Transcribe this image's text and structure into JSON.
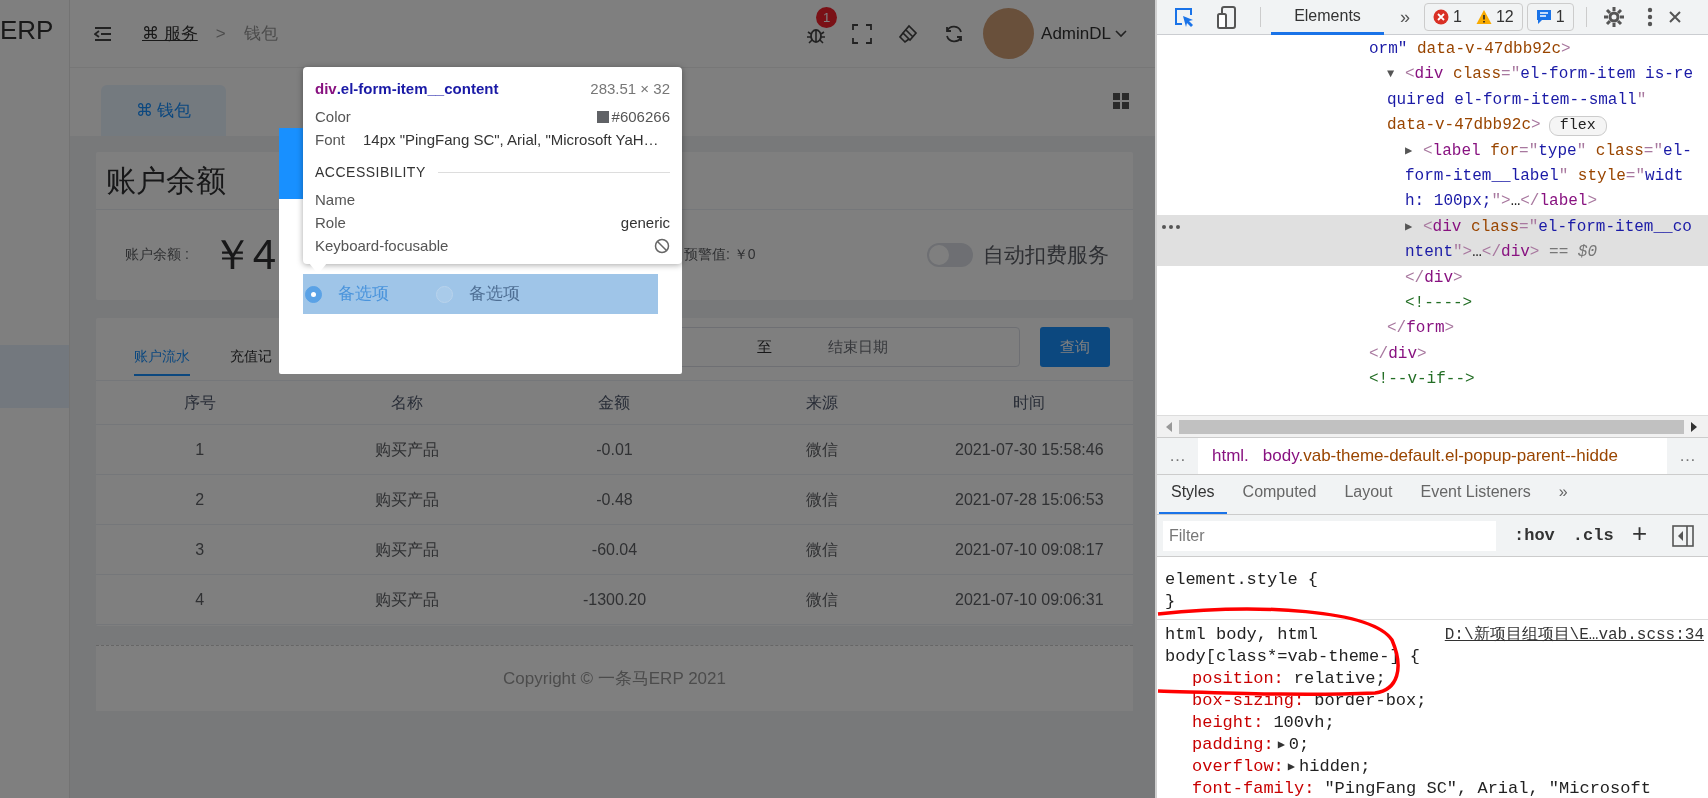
{
  "app": {
    "sidebar": {
      "logo_text": "ERP",
      "items": [
        {
          "selected": true
        }
      ]
    },
    "header": {
      "breadcrumb": [
        {
          "kind": "link",
          "text": "⌘ 服务"
        },
        {
          "kind": "separator",
          "text": ">"
        },
        {
          "kind": "current",
          "text": "钱包"
        }
      ],
      "notification_count": "1",
      "user": "AdminDL"
    },
    "tabs": [
      {
        "label": "⌘ 钱包",
        "selected": true
      }
    ],
    "balance_card": {
      "title": "账户余额",
      "balance_label": "账户余额 :",
      "balance_value": "￥4",
      "warning": "预警值: ￥0",
      "auto_pay": {
        "label": "自动扣费服务",
        "on": false
      }
    },
    "records_card": {
      "tabs": [
        {
          "label": "账户流水",
          "selected": true
        },
        {
          "label": "充值记",
          "selected": false
        }
      ],
      "date_range": {
        "separator": "至",
        "end_placeholder": "结束日期"
      },
      "query_button": "查询",
      "table": {
        "columns": [
          "序号",
          "名称",
          "金额",
          "来源",
          "时间"
        ],
        "rows": [
          [
            "1",
            "购买产品",
            "-0.01",
            "微信",
            "2021-07-30 15:58:46"
          ],
          [
            "2",
            "购买产品",
            "-0.48",
            "微信",
            "2021-07-28 15:06:53"
          ],
          [
            "3",
            "购买产品",
            "-60.04",
            "微信",
            "2021-07-10 09:08:17"
          ],
          [
            "4",
            "购买产品",
            "-1300.20",
            "微信",
            "2021-07-10 09:06:31"
          ]
        ]
      }
    },
    "footer": "Copyright © 一条马ERP 2021"
  },
  "dialog": {
    "options": [
      {
        "label": "备选项",
        "selected": true
      },
      {
        "label": "备选项",
        "selected": false
      }
    ]
  },
  "inspect_tooltip": {
    "tag": "div",
    "class_name": ".el-form-item__content",
    "size": "283.51 × 32",
    "rows": [
      {
        "kind": "color",
        "label": "Color",
        "value": "#606266"
      },
      {
        "kind": "text",
        "label": "Font",
        "value": "14px \"PingFang SC\", Arial, \"Microsoft YaH…"
      }
    ],
    "section": "ACCESSIBILITY",
    "a11y": [
      {
        "kind": "text",
        "label": "Name"
      },
      {
        "kind": "text",
        "label": "Role",
        "value": "generic"
      },
      {
        "kind": "blocked",
        "label": "Keyboard-focusable"
      }
    ]
  },
  "devtools": {
    "toolbar": {
      "inspect_selected": true,
      "tabs": [
        {
          "label": "Elements",
          "selected": true
        }
      ],
      "more": "»",
      "errors": "1",
      "warnings": "12",
      "messages": "1"
    },
    "dom_tree": [
      {
        "selected": false,
        "children": [
          {
            "selected": false,
            "lines": [
              [
                {
                  "kind": "value",
                  "text": "orm\""
                },
                {
                  "kind": "attr",
                  "text": " data-v-47dbb92c"
                },
                {
                  "kind": "punct",
                  "text": ">"
                }
              ]
            ],
            "children": [
              {
                "selected": false,
                "arrow": "▼",
                "lines": [
                  [
                    {
                      "kind": "punct",
                      "text": "<"
                    },
                    {
                      "kind": "tag",
                      "text": "div"
                    },
                    {
                      "kind": "attr",
                      "text": " class"
                    },
                    {
                      "kind": "punct",
                      "text": "=\""
                    },
                    {
                      "kind": "value",
                      "text": "el-form-item is-re"
                    }
                  ],
                  [
                    {
                      "kind": "value",
                      "text": "quired el-form-item--small"
                    },
                    {
                      "kind": "punct",
                      "text": "\""
                    }
                  ],
                  [
                    {
                      "kind": "attr",
                      "text": "data-v-47dbb92c"
                    },
                    {
                      "kind": "punct",
                      "text": ">"
                    },
                    {
                      "kind": "badge",
                      "text": "flex"
                    }
                  ]
                ],
                "children": [
                  {
                    "selected": false,
                    "arrow": "▶",
                    "lines": [
                      [
                        {
                          "kind": "punct",
                          "text": "<"
                        },
                        {
                          "kind": "tag",
                          "text": "label"
                        },
                        {
                          "kind": "attr",
                          "text": " for"
                        },
                        {
                          "kind": "punct",
                          "text": "=\""
                        },
                        {
                          "kind": "value",
                          "text": "type"
                        },
                        {
                          "kind": "punct",
                          "text": "\""
                        },
                        {
                          "kind": "attr",
                          "text": " class"
                        },
                        {
                          "kind": "punct",
                          "text": "=\""
                        },
                        {
                          "kind": "value",
                          "text": "el-"
                        }
                      ],
                      [
                        {
                          "kind": "value",
                          "text": "form-item__label"
                        },
                        {
                          "kind": "punct",
                          "text": "\""
                        },
                        {
                          "kind": "attr",
                          "text": " style"
                        },
                        {
                          "kind": "punct",
                          "text": "=\""
                        },
                        {
                          "kind": "value",
                          "text": "widt"
                        }
                      ],
                      [
                        {
                          "kind": "value",
                          "text": "h: 100px;"
                        },
                        {
                          "kind": "punct",
                          "text": "\">"
                        },
                        {
                          "kind": "plain",
                          "text": "…"
                        },
                        {
                          "kind": "punct",
                          "text": "</"
                        },
                        {
                          "kind": "tag",
                          "text": "label"
                        },
                        {
                          "kind": "punct",
                          "text": ">"
                        }
                      ]
                    ]
                  },
                  {
                    "selected": true,
                    "arrow": "▶",
                    "lines": [
                      [
                        {
                          "kind": "punct",
                          "text": "<"
                        },
                        {
                          "kind": "tag",
                          "text": "div"
                        },
                        {
                          "kind": "attr",
                          "text": " class"
                        },
                        {
                          "kind": "punct",
                          "text": "=\""
                        },
                        {
                          "kind": "value",
                          "text": "el-form-item__co"
                        }
                      ],
                      [
                        {
                          "kind": "value",
                          "text": "ntent"
                        },
                        {
                          "kind": "punct",
                          "text": "\">"
                        },
                        {
                          "kind": "plain",
                          "text": "…"
                        },
                        {
                          "kind": "punct",
                          "text": "</"
                        },
                        {
                          "kind": "tag",
                          "text": "div"
                        },
                        {
                          "kind": "punct",
                          "text": ">"
                        },
                        {
                          "kind": "dim",
                          "text": " == $0"
                        }
                      ]
                    ]
                  }
                ],
                "close": [
                  {
                    "kind": "punct",
                    "text": "</"
                  },
                  {
                    "kind": "tag",
                    "text": "div"
                  },
                  {
                    "kind": "punct",
                    "text": ">"
                  }
                ]
              },
              {
                "selected": false,
                "lines": [
                  [
                    {
                      "kind": "comment",
                      "text": "<!---->"
                    }
                  ]
                ]
              }
            ],
            "close": [
              {
                "kind": "punct",
                "text": "</"
              },
              {
                "kind": "tag",
                "text": "form"
              },
              {
                "kind": "punct",
                "text": ">"
              }
            ]
          }
        ],
        "close": [
          {
            "kind": "punct",
            "text": "</"
          },
          {
            "kind": "tag",
            "text": "div"
          },
          {
            "kind": "punct",
            "text": ">"
          }
        ]
      },
      {
        "selected": false,
        "lines": [
          [
            {
              "kind": "comment",
              "text": "<!--v-if-->"
            }
          ]
        ]
      }
    ],
    "breadcrumb": [
      {
        "kind": "more",
        "text": "…"
      },
      {
        "kind": "node",
        "tag": "html."
      },
      {
        "kind": "node",
        "tag": "body",
        "classes": ".vab-theme-default.el-popup-parent--hidde"
      },
      {
        "kind": "more",
        "text": "…"
      }
    ],
    "style_tabs": [
      {
        "label": "Styles",
        "selected": true
      },
      {
        "label": "Computed",
        "selected": false
      },
      {
        "label": "Layout",
        "selected": false
      },
      {
        "label": "Event Listeners",
        "selected": false
      },
      {
        "label": "»",
        "selected": false
      }
    ],
    "filter_placeholder": "Filter",
    "filter_buttons": [
      ":hov",
      ".cls",
      "+"
    ],
    "rules": [
      {
        "selector_lines": [
          "element.style {"
        ],
        "close": "}"
      },
      {
        "selector_lines": [
          "html body, html",
          "body[class*=vab-theme-] {"
        ],
        "source": "D:\\新项目组项目\\E…vab.scss:34",
        "declarations": [
          {
            "property": "position:",
            "value": "relative;"
          },
          {
            "property": "box-sizing:",
            "value": "border-box;"
          },
          {
            "property": "height:",
            "value": "100vh;"
          },
          {
            "property": "padding:",
            "toggle": "▶",
            "value": "0;"
          },
          {
            "property": "overflow:",
            "toggle": "▶",
            "value": "hidden;"
          },
          {
            "property": "font-family:",
            "value": "\"PingFang SC\", Arial, \"Microsoft"
          }
        ]
      }
    ]
  }
}
